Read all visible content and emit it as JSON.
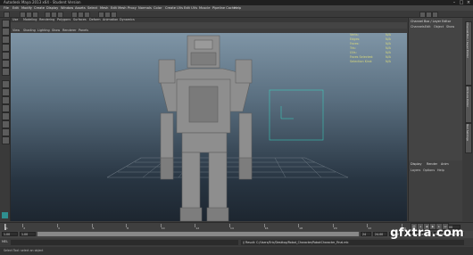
{
  "title_bar": {
    "title": "Autodesk Maya 2013 x64 - Student Version",
    "controls": [
      "minimize-icon",
      "maximize-icon",
      "close-icon"
    ]
  },
  "menu_bar": {
    "items": [
      "File",
      "Edit",
      "Modify",
      "Create",
      "Display",
      "Window",
      "Assets",
      "Select",
      "Mesh",
      "Edit Mesh",
      "Proxy",
      "Normals",
      "Color",
      "Create UVs",
      "Edit UVs",
      "Muscle",
      "Pipeline Cache",
      "Help"
    ]
  },
  "shelf_tabs": {
    "items": [
      "Use",
      "Modeling",
      "Rendering",
      "Polygons",
      "Surfaces",
      "Deform",
      "Animation",
      "Dynamics"
    ]
  },
  "panel_menu": {
    "items": [
      "View",
      "Shading",
      "Lighting",
      "Show",
      "Renderer",
      "Panels"
    ]
  },
  "hud": {
    "rows": [
      {
        "label": "Verts:",
        "value": "N/A"
      },
      {
        "label": "Edges:",
        "value": "N/A"
      },
      {
        "label": "Faces:",
        "value": "N/A"
      },
      {
        "label": "Tris:",
        "value": "N/A"
      },
      {
        "label": "UVs:",
        "value": "N/A"
      },
      {
        "label": "Faces Selected:",
        "value": "N/A"
      },
      {
        "label": "Selection Kind:",
        "value": "N/A"
      }
    ]
  },
  "channel_box": {
    "title": "Channel Box / Layer Editor",
    "menu": [
      "Channels",
      "Edit",
      "Object",
      "Show"
    ]
  },
  "side_tabs": [
    "Channel Box / Layer Editor",
    "Attribute Editor",
    "Tool Settings"
  ],
  "layer_editor": {
    "tabs": [
      "Display",
      "Render",
      "Anim"
    ],
    "menu": [
      "Layers",
      "Options",
      "Help"
    ]
  },
  "time_slider": {
    "ticks": [
      "1",
      "2",
      "4",
      "6",
      "8",
      "10",
      "12",
      "14",
      "16",
      "18",
      "20",
      "22",
      "24"
    ],
    "current_frame": "1.00"
  },
  "range_slider": {
    "start": "1.00",
    "playback_start": "1.00",
    "playback_end": "24",
    "end": "24.00",
    "end2": "48.00",
    "anim_layer": "No Anim Layer",
    "char_set": "No Character Set"
  },
  "playback_buttons": [
    "go-to-start-icon",
    "step-back-icon",
    "play-back-icon",
    "play-forward-icon",
    "step-forward-icon",
    "go-to-end-icon"
  ],
  "command_line": {
    "label": "MEL",
    "result": "// Result: C:/Users/Eric/Desktop/Robot_Character/RobotCharacter_Final.mb"
  },
  "help_line": {
    "text": "Select Tool: select an object"
  },
  "watermark": {
    "text": "gfxtra.com"
  },
  "colors": {
    "hud_text": "#d8d87a",
    "viewport_top": "#7f95a6",
    "viewport_bottom": "#1d2630",
    "robot": "#8e8e8e",
    "wire": "#35e0c8"
  }
}
